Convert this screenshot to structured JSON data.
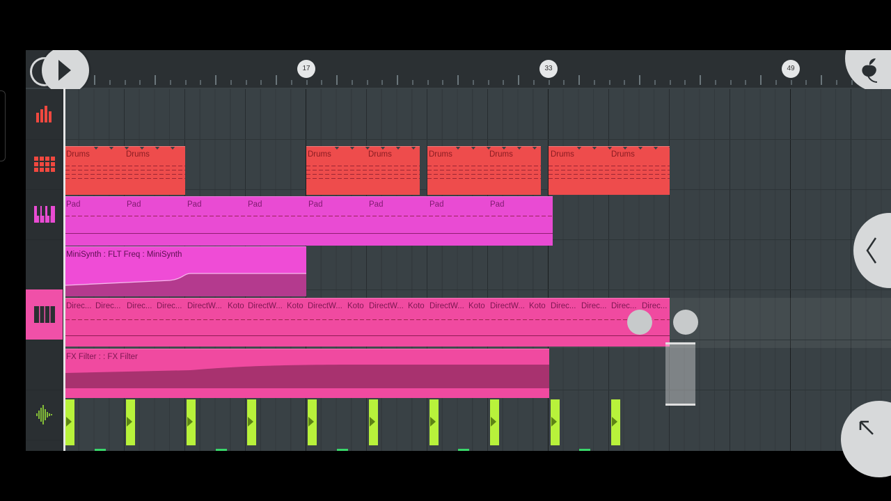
{
  "ruler": {
    "markers": [
      "17",
      "33",
      "49"
    ]
  },
  "tracks": [
    {
      "icon": "mixer-bars-icon",
      "color": "#f0483f"
    },
    {
      "icon": "step-sequencer-icon",
      "color": "#f0483f"
    },
    {
      "icon": "piano-keys-icon",
      "color": "#e94bd3"
    },
    {
      "icon": "none",
      "color": ""
    },
    {
      "icon": "piano-keys-icon",
      "color": "#2a2f32",
      "active": true
    },
    {
      "icon": "none",
      "color": ""
    },
    {
      "icon": "waveform-icon",
      "color": "#9be23a"
    }
  ],
  "clips": {
    "drums": [
      "Drums",
      "Drums",
      "Drums",
      "Drums",
      "Drums",
      "Drums",
      "Drums",
      "Drums"
    ],
    "pad": [
      "Pad",
      "Pad",
      "Pad",
      "Pad",
      "Pad",
      "Pad",
      "Pad",
      "Pad"
    ],
    "automation": "MiniSynth : FLT Freq : MiniSynth",
    "koto": [
      "Direc...",
      "Direc...",
      "Direc...",
      "Direc...",
      "DirectW...",
      "Koto",
      "DirectW...",
      "Koto",
      "DirectW...",
      "Koto",
      "DirectW...",
      "Koto",
      "DirectW...",
      "Koto",
      "DirectW...",
      "Koto",
      "Direc...",
      "Direc...",
      "Direc...",
      "Direc..."
    ],
    "fx": "FX Filter :  : FX Filter"
  },
  "colors": {
    "drums": "#ee4c4c",
    "pad": "#e94bd3",
    "koto": "#f04aa0",
    "audio": "#b8f23b",
    "background": "#394145"
  }
}
